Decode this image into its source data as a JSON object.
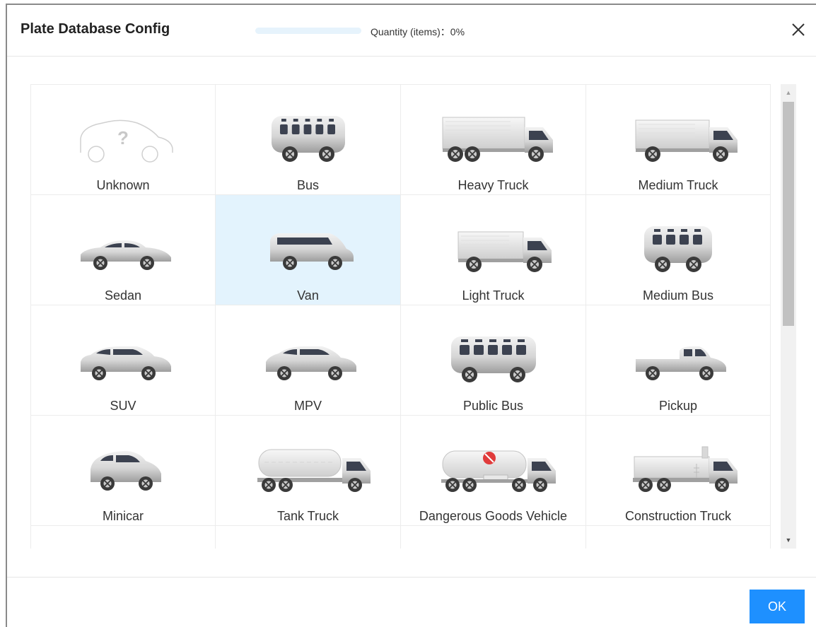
{
  "dialog": {
    "title": "Plate Database Config",
    "quantity_text": "Quantity (items)：0%",
    "progress_percent": 0,
    "ok_label": "OK"
  },
  "vehicles": [
    {
      "label": "Unknown",
      "icon": "unknown-car-icon"
    },
    {
      "label": "Bus",
      "icon": "bus-icon"
    },
    {
      "label": "Heavy Truck",
      "icon": "heavy-truck-icon"
    },
    {
      "label": "Medium Truck",
      "icon": "medium-truck-icon"
    },
    {
      "label": "Sedan",
      "icon": "sedan-icon"
    },
    {
      "label": "Van",
      "icon": "van-icon",
      "selected": true
    },
    {
      "label": "Light Truck",
      "icon": "light-truck-icon"
    },
    {
      "label": "Medium Bus",
      "icon": "medium-bus-icon"
    },
    {
      "label": "SUV",
      "icon": "suv-icon"
    },
    {
      "label": "MPV",
      "icon": "mpv-icon"
    },
    {
      "label": "Public Bus",
      "icon": "public-bus-icon"
    },
    {
      "label": "Pickup",
      "icon": "pickup-icon"
    },
    {
      "label": "Minicar",
      "icon": "minicar-icon"
    },
    {
      "label": "Tank Truck",
      "icon": "tank-truck-icon"
    },
    {
      "label": "Dangerous Goods Vehicle",
      "icon": "dangerous-goods-vehicle-icon"
    },
    {
      "label": "Construction Truck",
      "icon": "construction-truck-icon"
    },
    {
      "label": "",
      "icon": ""
    },
    {
      "label": "",
      "icon": ""
    },
    {
      "label": "",
      "icon": ""
    },
    {
      "label": "",
      "icon": ""
    }
  ],
  "colors": {
    "accent": "#1e90ff",
    "selected_bg": "#e3f3fd",
    "progress_track": "#e6f3fc"
  }
}
